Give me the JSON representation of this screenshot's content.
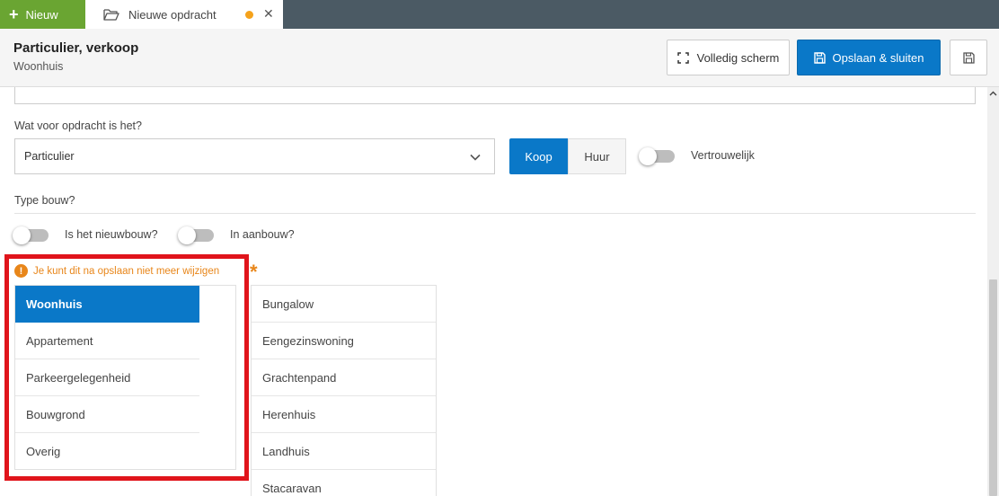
{
  "topbar": {
    "new_label": "Nieuw",
    "tab_label": "Nieuwe opdracht",
    "tab_close": "✕",
    "accent_green": "#6aa532",
    "unsaved_dot_color": "#f5a21b"
  },
  "header": {
    "title": "Particulier, verkoop",
    "subtitle": "Woonhuis",
    "fullscreen_label": "Volledig scherm",
    "save_close_label": "Opslaan & sluiten"
  },
  "form": {
    "question_label": "Wat voor opdracht is het?",
    "select_value": "Particulier",
    "segment": {
      "koop": "Koop",
      "huur": "Huur",
      "selected": "Koop"
    },
    "vertrouwelijk_label": "Vertrouwelijk",
    "type_bouw_label": "Type bouw?",
    "nieuwbouw_label": "Is het nieuwbouw?",
    "aanbouw_label": "In aanbouw?",
    "warning_text": "Je kunt dit na opslaan niet meer wijzigen",
    "required_marker": "*",
    "categories": [
      "Woonhuis",
      "Appartement",
      "Parkeergelegenheid",
      "Bouwgrond",
      "Overig"
    ],
    "selected_category": "Woonhuis",
    "subtypes": [
      "Bungalow",
      "Eengezinswoning",
      "Grachtenpand",
      "Herenhuis",
      "Landhuis",
      "Stacaravan"
    ]
  },
  "colors": {
    "primary": "#0a78c8",
    "warning": "#e8861a",
    "highlight_border": "#e0141b"
  }
}
